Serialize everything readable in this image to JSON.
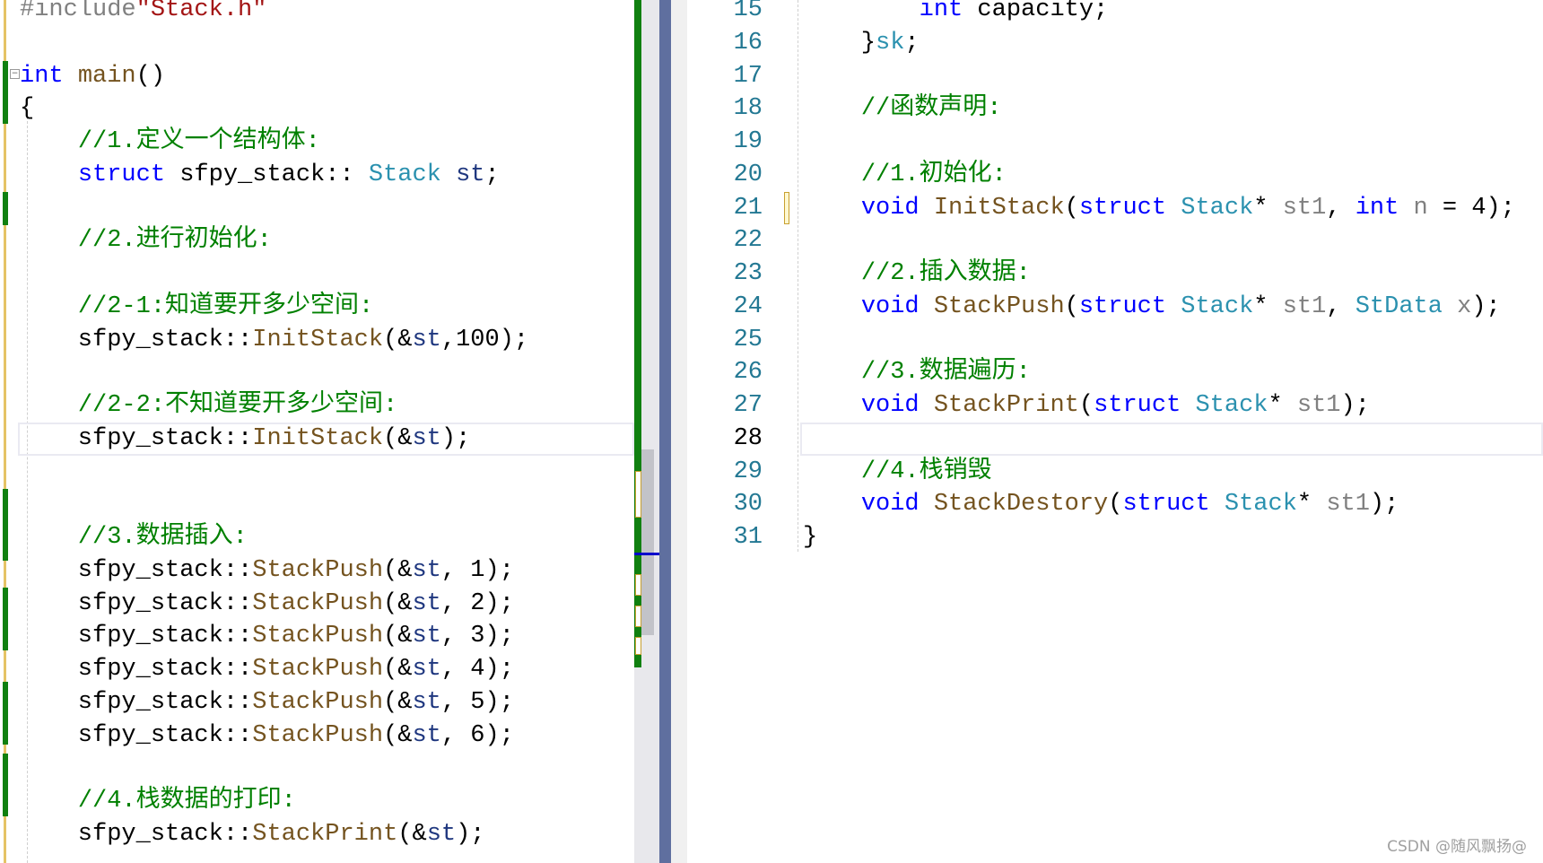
{
  "left_editor": {
    "lines": [
      [
        [
          "pp",
          "#include"
        ],
        [
          "str",
          "\"Stack.h\""
        ]
      ],
      [],
      [
        [
          "kw",
          "int"
        ],
        [
          "pl",
          " "
        ],
        [
          "fn",
          "main"
        ],
        [
          "pl",
          "()"
        ]
      ],
      [
        [
          "pl",
          "{"
        ]
      ],
      [
        [
          "pl",
          "    "
        ],
        [
          "cm",
          "//1.定义一个结构体:"
        ]
      ],
      [
        [
          "pl",
          "    "
        ],
        [
          "kw",
          "struct"
        ],
        [
          "pl",
          " sfpy_stack:: "
        ],
        [
          "ty",
          "Stack"
        ],
        [
          "pl",
          " "
        ],
        [
          "var",
          "st"
        ],
        [
          "pl",
          ";"
        ]
      ],
      [],
      [
        [
          "pl",
          "    "
        ],
        [
          "cm",
          "//2.进行初始化:"
        ]
      ],
      [],
      [
        [
          "pl",
          "    "
        ],
        [
          "cm",
          "//2-1:知道要开多少空间:"
        ]
      ],
      [
        [
          "pl",
          "    sfpy_stack::"
        ],
        [
          "fn",
          "InitStack"
        ],
        [
          "pl",
          "(&"
        ],
        [
          "var",
          "st"
        ],
        [
          "pl",
          ",100);"
        ]
      ],
      [],
      [
        [
          "pl",
          "    "
        ],
        [
          "cm",
          "//2-2:不知道要开多少空间:"
        ]
      ],
      [
        [
          "pl",
          "    sfpy_stack::"
        ],
        [
          "fn",
          "InitStack"
        ],
        [
          "pl",
          "(&"
        ],
        [
          "var",
          "st"
        ],
        [
          "pl",
          ");"
        ]
      ],
      [],
      [],
      [
        [
          "pl",
          "    "
        ],
        [
          "cm",
          "//3.数据插入:"
        ]
      ],
      [
        [
          "pl",
          "    sfpy_stack::"
        ],
        [
          "fn",
          "StackPush"
        ],
        [
          "pl",
          "(&"
        ],
        [
          "var",
          "st"
        ],
        [
          "pl",
          ", 1);"
        ]
      ],
      [
        [
          "pl",
          "    sfpy_stack::"
        ],
        [
          "fn",
          "StackPush"
        ],
        [
          "pl",
          "(&"
        ],
        [
          "var",
          "st"
        ],
        [
          "pl",
          ", 2);"
        ]
      ],
      [
        [
          "pl",
          "    sfpy_stack::"
        ],
        [
          "fn",
          "StackPush"
        ],
        [
          "pl",
          "(&"
        ],
        [
          "var",
          "st"
        ],
        [
          "pl",
          ", 3);"
        ]
      ],
      [
        [
          "pl",
          "    sfpy_stack::"
        ],
        [
          "fn",
          "StackPush"
        ],
        [
          "pl",
          "(&"
        ],
        [
          "var",
          "st"
        ],
        [
          "pl",
          ", 4);"
        ]
      ],
      [
        [
          "pl",
          "    sfpy_stack::"
        ],
        [
          "fn",
          "StackPush"
        ],
        [
          "pl",
          "(&"
        ],
        [
          "var",
          "st"
        ],
        [
          "pl",
          ", 5);"
        ]
      ],
      [
        [
          "pl",
          "    sfpy_stack::"
        ],
        [
          "fn",
          "StackPush"
        ],
        [
          "pl",
          "(&"
        ],
        [
          "var",
          "st"
        ],
        [
          "pl",
          ", 6);"
        ]
      ],
      [],
      [
        [
          "pl",
          "    "
        ],
        [
          "cm",
          "//4.栈数据的打印:"
        ]
      ],
      [
        [
          "pl",
          "    sfpy_stack::"
        ],
        [
          "fn",
          "StackPrint"
        ],
        [
          "pl",
          "(&"
        ],
        [
          "var",
          "st"
        ],
        [
          "pl",
          ");"
        ]
      ]
    ],
    "current_line_index": 13
  },
  "right_editor": {
    "line_numbers": [
      "15",
      "16",
      "17",
      "18",
      "19",
      "20",
      "21",
      "22",
      "23",
      "24",
      "25",
      "26",
      "27",
      "28",
      "29",
      "30",
      "31"
    ],
    "current_line_number": "28",
    "lines": [
      [
        [
          "pl",
          "        "
        ],
        [
          "kw",
          "int"
        ],
        [
          "pl",
          " capacity;"
        ]
      ],
      [
        [
          "pl",
          "    }"
        ],
        [
          "ty",
          "sk"
        ],
        [
          "pl",
          ";"
        ]
      ],
      [],
      [
        [
          "pl",
          "    "
        ],
        [
          "cm",
          "//函数声明:"
        ]
      ],
      [],
      [
        [
          "pl",
          "    "
        ],
        [
          "cm",
          "//1.初始化:"
        ]
      ],
      [
        [
          "pl",
          "    "
        ],
        [
          "kw",
          "void"
        ],
        [
          "pl",
          " "
        ],
        [
          "fn",
          "InitStack"
        ],
        [
          "pl",
          "("
        ],
        [
          "kw",
          "struct"
        ],
        [
          "pl",
          " "
        ],
        [
          "ty",
          "Stack"
        ],
        [
          "pl",
          "* "
        ],
        [
          "par",
          "st1"
        ],
        [
          "pl",
          ", "
        ],
        [
          "kw",
          "int"
        ],
        [
          "pl",
          " "
        ],
        [
          "par",
          "n"
        ],
        [
          "pl",
          " = 4);"
        ]
      ],
      [],
      [
        [
          "pl",
          "    "
        ],
        [
          "cm",
          "//2.插入数据:"
        ]
      ],
      [
        [
          "pl",
          "    "
        ],
        [
          "kw",
          "void"
        ],
        [
          "pl",
          " "
        ],
        [
          "fn",
          "StackPush"
        ],
        [
          "pl",
          "("
        ],
        [
          "kw",
          "struct"
        ],
        [
          "pl",
          " "
        ],
        [
          "ty",
          "Stack"
        ],
        [
          "pl",
          "* "
        ],
        [
          "par",
          "st1"
        ],
        [
          "pl",
          ", "
        ],
        [
          "ty",
          "StData"
        ],
        [
          "pl",
          " "
        ],
        [
          "par",
          "x"
        ],
        [
          "pl",
          ");"
        ]
      ],
      [],
      [
        [
          "pl",
          "    "
        ],
        [
          "cm",
          "//3.数据遍历:"
        ]
      ],
      [
        [
          "pl",
          "    "
        ],
        [
          "kw",
          "void"
        ],
        [
          "pl",
          " "
        ],
        [
          "fn",
          "StackPrint"
        ],
        [
          "pl",
          "("
        ],
        [
          "kw",
          "struct"
        ],
        [
          "pl",
          " "
        ],
        [
          "ty",
          "Stack"
        ],
        [
          "pl",
          "* "
        ],
        [
          "par",
          "st1"
        ],
        [
          "pl",
          ");"
        ]
      ],
      [],
      [
        [
          "pl",
          "    "
        ],
        [
          "cm",
          "//4.栈销毁"
        ]
      ],
      [
        [
          "pl",
          "    "
        ],
        [
          "kw",
          "void"
        ],
        [
          "pl",
          " "
        ],
        [
          "fn",
          "StackDestory"
        ],
        [
          "pl",
          "("
        ],
        [
          "kw",
          "struct"
        ],
        [
          "pl",
          " "
        ],
        [
          "ty",
          "Stack"
        ],
        [
          "pl",
          "* "
        ],
        [
          "par",
          "st1"
        ],
        [
          "pl",
          ");"
        ]
      ],
      [
        [
          "pl",
          "}"
        ]
      ]
    ]
  },
  "colors": {
    "keyword": "#0000ff",
    "type": "#2b91af",
    "function": "#74531f",
    "comment": "#008000",
    "string": "#a31515",
    "splitter": "#5f6f9f"
  },
  "watermark": "CSDN @随风飘扬@"
}
